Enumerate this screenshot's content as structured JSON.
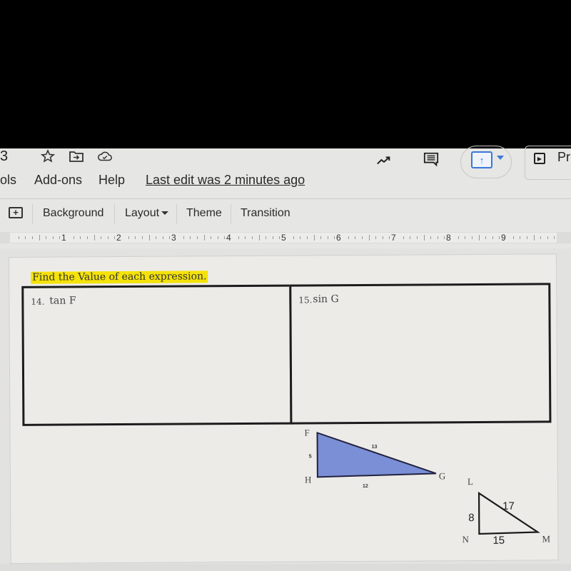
{
  "title_bar": {
    "doc_title_fragment": "3",
    "icons": [
      "star-icon",
      "move-to-folder-icon",
      "cloud-saved-icon"
    ],
    "right_icons": [
      "activity-trend-icon",
      "comments-icon",
      "share-icon"
    ],
    "share_arrow": "↑",
    "present_label": "Pr"
  },
  "menu": {
    "items": [
      "ols",
      "Add-ons",
      "Help"
    ],
    "last_edit": "Last edit was 2 minutes ago"
  },
  "toolbar": {
    "new_comment_symbol": "+",
    "background_label": "Background",
    "layout_label": "Layout",
    "theme_label": "Theme",
    "transition_label": "Transition"
  },
  "ruler": {
    "numbers": [
      "1",
      "2",
      "3",
      "4",
      "5",
      "6",
      "7",
      "8",
      "9"
    ]
  },
  "slide": {
    "instruction": "Find the Value of each expression.",
    "highlight_color": "#f4e20a",
    "problems": [
      {
        "number": "14.",
        "expression": "tan F"
      },
      {
        "number": "15.",
        "expression": "sin G"
      }
    ],
    "triangle_fgh": {
      "fill_color": "#7b8fd6",
      "vertices": {
        "F": "F",
        "G": "G",
        "H": "H"
      },
      "sides": {
        "FH": "5",
        "FG": "13",
        "HG": "12"
      }
    },
    "triangle_lmn": {
      "vertices": {
        "L": "L",
        "M": "M",
        "N": "N"
      },
      "sides": {
        "LN": "8",
        "LM": "17",
        "NM": "15"
      }
    }
  }
}
